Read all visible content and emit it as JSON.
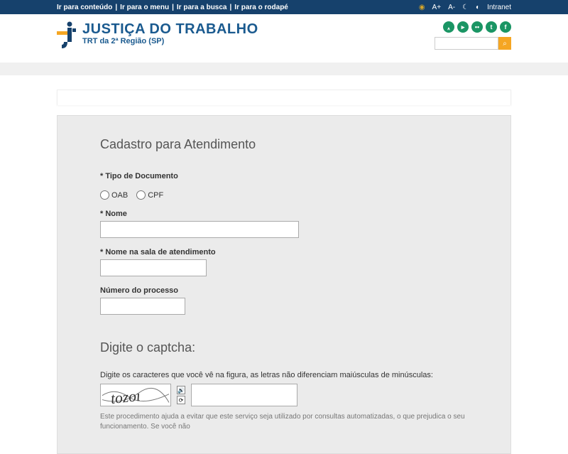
{
  "topbar": {
    "skip_content": "Ir para conteúdo",
    "skip_menu": "Ir para o menu",
    "skip_search": "Ir para a busca",
    "skip_footer": "Ir para o rodapé",
    "font_plus": "A+",
    "font_minus": "A-",
    "intranet": "Intranet"
  },
  "logo": {
    "main": "JUSTIÇA DO TRABALHO",
    "sub": "TRT da 2ª Região (SP)"
  },
  "search": {
    "placeholder": ""
  },
  "social": {
    "rss": "rss-icon",
    "youtube": "youtube-icon",
    "flickr": "flickr-icon",
    "twitter": "twitter-icon",
    "facebook": "facebook-icon"
  },
  "form": {
    "title": "Cadastro para Atendimento",
    "doc_type_label": "* Tipo de Documento",
    "radio_oab": "OAB",
    "radio_cpf": "CPF",
    "nome_label": "* Nome",
    "nome_sala_label": "* Nome na sala de atendimento",
    "processo_label": "Número do processo",
    "nome_value": "",
    "nome_sala_value": "",
    "processo_value": ""
  },
  "captcha": {
    "title": "Digite o captcha:",
    "instruction": "Digite os caracteres que você vê na figura, as letras não diferenciam maiúsculas de minúsculas:",
    "note": "Este procedimento ajuda a evitar que este serviço seja utilizado por consultas automatizadas, o que prejudica o seu funcionamento. Se você não",
    "input_value": ""
  }
}
